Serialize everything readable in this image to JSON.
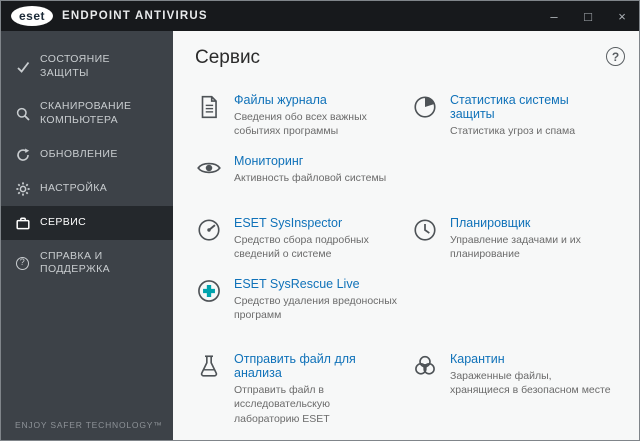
{
  "window": {
    "logo_text": "eset",
    "title": "ENDPOINT ANTIVIRUS",
    "controls": {
      "minimize": "–",
      "maximize": "□",
      "close": "×"
    }
  },
  "sidebar": {
    "items": [
      {
        "label": "СОСТОЯНИЕ ЗАЩИТЫ",
        "icon": "check-icon"
      },
      {
        "label": "СКАНИРОВАНИЕ КОМПЬЮТЕРА",
        "icon": "search-icon"
      },
      {
        "label": "ОБНОВЛЕНИЕ",
        "icon": "refresh-icon"
      },
      {
        "label": "НАСТРОЙКА",
        "icon": "gear-icon"
      },
      {
        "label": "СЕРВИС",
        "icon": "toolbox-icon",
        "active": true
      },
      {
        "label": "СПРАВКА И ПОДДЕРЖКА",
        "icon": "question-icon",
        "glyph": "?"
      }
    ],
    "footer": "ENJOY SAFER TECHNOLOGY™"
  },
  "main": {
    "title": "Сервис",
    "help_glyph": "?",
    "groups": [
      {
        "items": [
          {
            "title": "Файлы журнала",
            "desc": "Сведения обо всех важных событиях программы",
            "icon": "log-files-icon"
          },
          {
            "title": "Статистика системы защиты",
            "desc": "Статистика угроз и спама",
            "icon": "pie-chart-icon"
          },
          {
            "title": "Мониторинг",
            "desc": "Активность файловой системы",
            "icon": "eye-icon"
          }
        ]
      },
      {
        "items": [
          {
            "title": "ESET SysInspector",
            "desc": "Средство сбора подробных сведений о системе",
            "icon": "gauge-icon"
          },
          {
            "title": "Планировщик",
            "desc": "Управление задачами и их планирование",
            "icon": "clock-icon"
          },
          {
            "title": "ESET SysRescue Live",
            "desc": "Средство удаления вредоносных программ",
            "icon": "medical-cross-icon"
          }
        ]
      },
      {
        "items": [
          {
            "title": "Отправить файл для анализа",
            "desc": "Отправить файл в исследовательскую лабораторию ESET",
            "icon": "flask-icon"
          },
          {
            "title": "Карантин",
            "desc": "Зараженные файлы, хранящиеся в безопасном месте",
            "icon": "biohazard-icon"
          }
        ]
      }
    ]
  }
}
